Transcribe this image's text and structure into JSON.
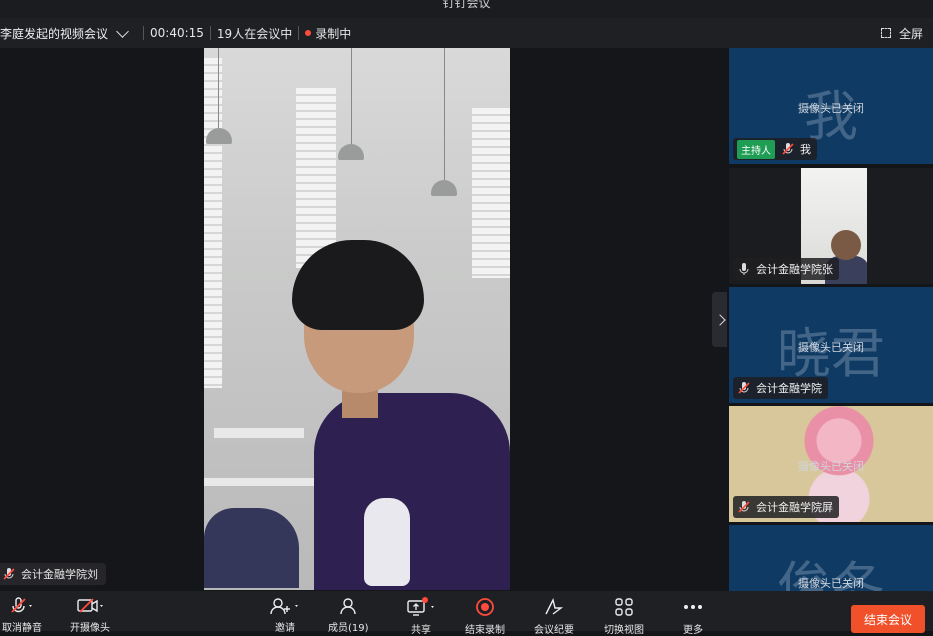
{
  "app": {
    "title": "钉钉会议"
  },
  "info_bar": {
    "meeting_name": "李庭发起的视频会议",
    "duration": "00:40:15",
    "participants_status": "19人在会议中",
    "recording_status": "录制中",
    "fullscreen_label": "全屏"
  },
  "main_speaker": {
    "label": "会计金融学院刘"
  },
  "sidebar": {
    "tiles": [
      {
        "big_text": "我",
        "camera_status": "摄像头已关闭",
        "host_badge": "主持人",
        "name": "我"
      },
      {
        "big_text": "",
        "camera_status": "",
        "name": "会计金融学院张"
      },
      {
        "big_text": "晓君",
        "camera_status": "摄像头已关闭",
        "name": "会计金融学院"
      },
      {
        "big_text": "",
        "camera_status": "摄像头已关闭",
        "name": "会计金融学院屏"
      },
      {
        "big_text": "俊冬",
        "camera_status": "摄像头已关闭",
        "name": ""
      }
    ]
  },
  "toolbar": {
    "unmute": "取消静音",
    "camera": "开摄像头",
    "invite": "邀请",
    "members": "成员(19)",
    "share": "共享",
    "end_recording": "结束录制",
    "minutes": "会议纪要",
    "switch_view": "切换视图",
    "more": "更多",
    "end_meeting": "结束会议"
  },
  "colors": {
    "accent_red": "#f0502a",
    "host_green": "#1f9d55",
    "tile_blue": "#0f3a63"
  }
}
